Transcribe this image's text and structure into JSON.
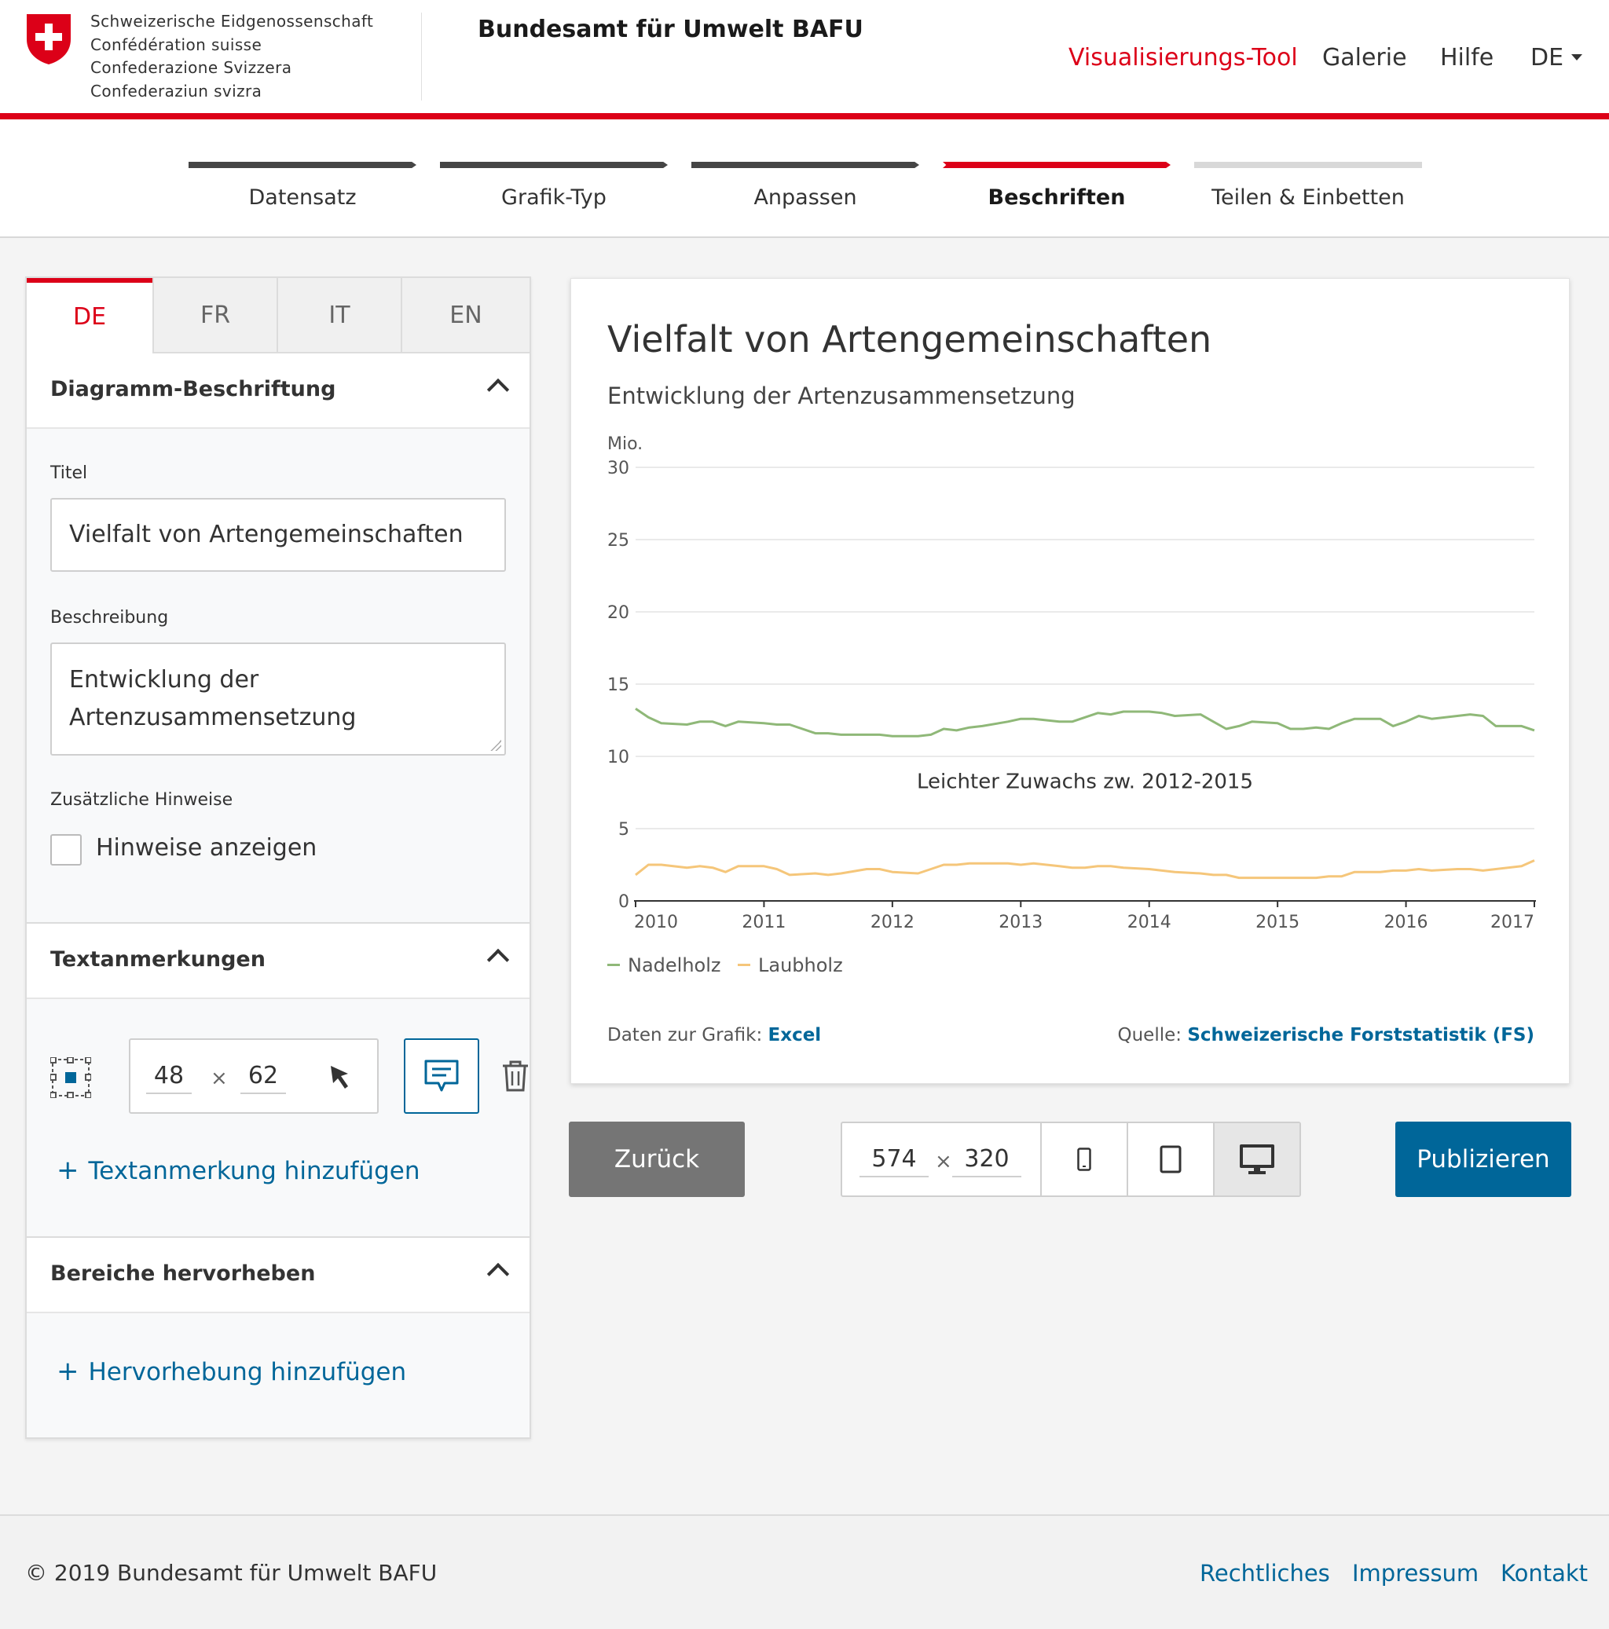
{
  "header": {
    "confederation_names": [
      "Schweizerische Eidgenossenschaft",
      "Confédération suisse",
      "Confederazione Svizzera",
      "Confederaziun svizra"
    ],
    "office": "Bundesamt für Umwelt BAFU",
    "nav": {
      "tool": "Visualisierungs-Tool",
      "gallery": "Galerie",
      "help": "Hilfe",
      "language": "DE"
    },
    "accent_color": "#dc0018"
  },
  "stepper": {
    "steps": [
      {
        "label": "Datensatz",
        "state": "done"
      },
      {
        "label": "Grafik-Typ",
        "state": "done"
      },
      {
        "label": "Anpassen",
        "state": "done"
      },
      {
        "label": "Beschriften",
        "state": "active"
      },
      {
        "label": "Teilen & Einbetten",
        "state": "todo"
      }
    ]
  },
  "panel": {
    "lang_tabs": [
      "DE",
      "FR",
      "IT",
      "EN"
    ],
    "active_tab": "DE",
    "chart_labels": {
      "heading": "Diagramm-Beschriftung",
      "title_label": "Titel",
      "title_value": "Vielfalt von Artengemeinschaften",
      "description_label": "Beschreibung",
      "description_line1": "Entwicklung der",
      "description_line2": "Artenzusammensetzung",
      "notes_label": "Zusätzliche Hinweise",
      "notes_checkbox": "Hinweise anzeigen",
      "notes_checked": false
    },
    "annotations": {
      "heading": "Textanmerkungen",
      "pos_x": "48",
      "pos_y": "62",
      "times": "×",
      "add_label": "Textanmerkung hinzufügen"
    },
    "highlights": {
      "heading": "Bereiche hervorheben",
      "add_label": "Hervorhebung hinzufügen"
    },
    "plus": "+"
  },
  "chart_card": {
    "title": "Vielfalt von Artengemeinschaften",
    "subtitle": "Entwicklung der Artenzusammensetzung",
    "data_prefix": "Daten zur Grafik:",
    "data_link": "Excel",
    "source_prefix": "Quelle:",
    "source_link": "Schweizerische Forststatistik (FS)"
  },
  "chart_data": {
    "type": "line",
    "title": "Vielfalt von Artengemeinschaften",
    "subtitle": "Entwicklung der Artenzusammensetzung",
    "ylabel": "Mio.",
    "ylim": [
      0,
      30
    ],
    "yticks": [
      0,
      5,
      10,
      15,
      20,
      25,
      30
    ],
    "xlim": [
      2010,
      2017
    ],
    "xticks": [
      2010,
      2011,
      2012,
      2013,
      2014,
      2015,
      2016,
      2017
    ],
    "grid": true,
    "legend": "bottom-left",
    "annotation": {
      "text": "Leichter Zuwachs zw. 2012-2015",
      "x": 2013.5,
      "y": 7.8
    },
    "series": [
      {
        "name": "Nadelholz",
        "color": "#8fb878",
        "x": [
          2010.0,
          2010.1,
          2010.2,
          2010.4,
          2010.5,
          2010.6,
          2010.7,
          2010.8,
          2011.0,
          2011.1,
          2011.2,
          2011.4,
          2011.5,
          2011.6,
          2011.8,
          2011.9,
          2012.0,
          2012.2,
          2012.3,
          2012.4,
          2012.5,
          2012.6,
          2012.7,
          2012.9,
          2013.0,
          2013.1,
          2013.3,
          2013.4,
          2013.5,
          2013.6,
          2013.7,
          2013.8,
          2014.0,
          2014.1,
          2014.2,
          2014.4,
          2014.5,
          2014.6,
          2014.7,
          2014.8,
          2015.0,
          2015.1,
          2015.2,
          2015.3,
          2015.4,
          2015.5,
          2015.6,
          2015.8,
          2015.9,
          2016.0,
          2016.1,
          2016.2,
          2016.4,
          2016.5,
          2016.6,
          2016.7,
          2016.9,
          2017.0
        ],
        "values": [
          13.3,
          12.7,
          12.3,
          12.2,
          12.4,
          12.4,
          12.1,
          12.4,
          12.3,
          12.2,
          12.2,
          11.6,
          11.6,
          11.5,
          11.5,
          11.5,
          11.4,
          11.4,
          11.5,
          11.9,
          11.8,
          12.0,
          12.1,
          12.4,
          12.6,
          12.6,
          12.4,
          12.4,
          12.7,
          13.0,
          12.9,
          13.1,
          13.1,
          13.0,
          12.8,
          12.9,
          12.4,
          11.9,
          12.1,
          12.4,
          12.3,
          11.9,
          11.9,
          12.0,
          11.9,
          12.3,
          12.6,
          12.6,
          12.1,
          12.4,
          12.8,
          12.6,
          12.8,
          12.9,
          12.8,
          12.1,
          12.1,
          11.8
        ]
      },
      {
        "name": "Laubholz",
        "color": "#f5c67a",
        "x": [
          2010.0,
          2010.1,
          2010.2,
          2010.4,
          2010.5,
          2010.6,
          2010.7,
          2010.8,
          2011.0,
          2011.1,
          2011.2,
          2011.4,
          2011.5,
          2011.6,
          2011.8,
          2011.9,
          2012.0,
          2012.2,
          2012.3,
          2012.4,
          2012.5,
          2012.6,
          2012.7,
          2012.9,
          2013.0,
          2013.1,
          2013.3,
          2013.4,
          2013.5,
          2013.6,
          2013.7,
          2013.8,
          2014.0,
          2014.1,
          2014.2,
          2014.4,
          2014.5,
          2014.6,
          2014.7,
          2014.8,
          2015.0,
          2015.1,
          2015.2,
          2015.3,
          2015.4,
          2015.5,
          2015.6,
          2015.8,
          2015.9,
          2016.0,
          2016.1,
          2016.2,
          2016.4,
          2016.5,
          2016.6,
          2016.7,
          2016.9,
          2017.0
        ],
        "values": [
          1.8,
          2.5,
          2.5,
          2.3,
          2.4,
          2.3,
          2.0,
          2.4,
          2.4,
          2.2,
          1.8,
          1.9,
          1.8,
          1.9,
          2.2,
          2.2,
          2.0,
          1.9,
          2.2,
          2.5,
          2.5,
          2.6,
          2.6,
          2.6,
          2.5,
          2.6,
          2.4,
          2.3,
          2.3,
          2.4,
          2.4,
          2.3,
          2.2,
          2.1,
          2.0,
          1.9,
          1.8,
          1.8,
          1.6,
          1.6,
          1.6,
          1.6,
          1.6,
          1.6,
          1.7,
          1.7,
          2.0,
          2.0,
          2.1,
          2.1,
          2.2,
          2.1,
          2.2,
          2.2,
          2.1,
          2.2,
          2.4,
          2.8
        ]
      }
    ]
  },
  "actions": {
    "back": "Zurück",
    "width": "574",
    "height": "320",
    "times": "×",
    "publish": "Publizieren"
  },
  "footer": {
    "copyright": "© 2019 Bundesamt für Umwelt BAFU",
    "legal": "Rechtliches",
    "imprint": "Impressum",
    "contact": "Kontakt"
  }
}
